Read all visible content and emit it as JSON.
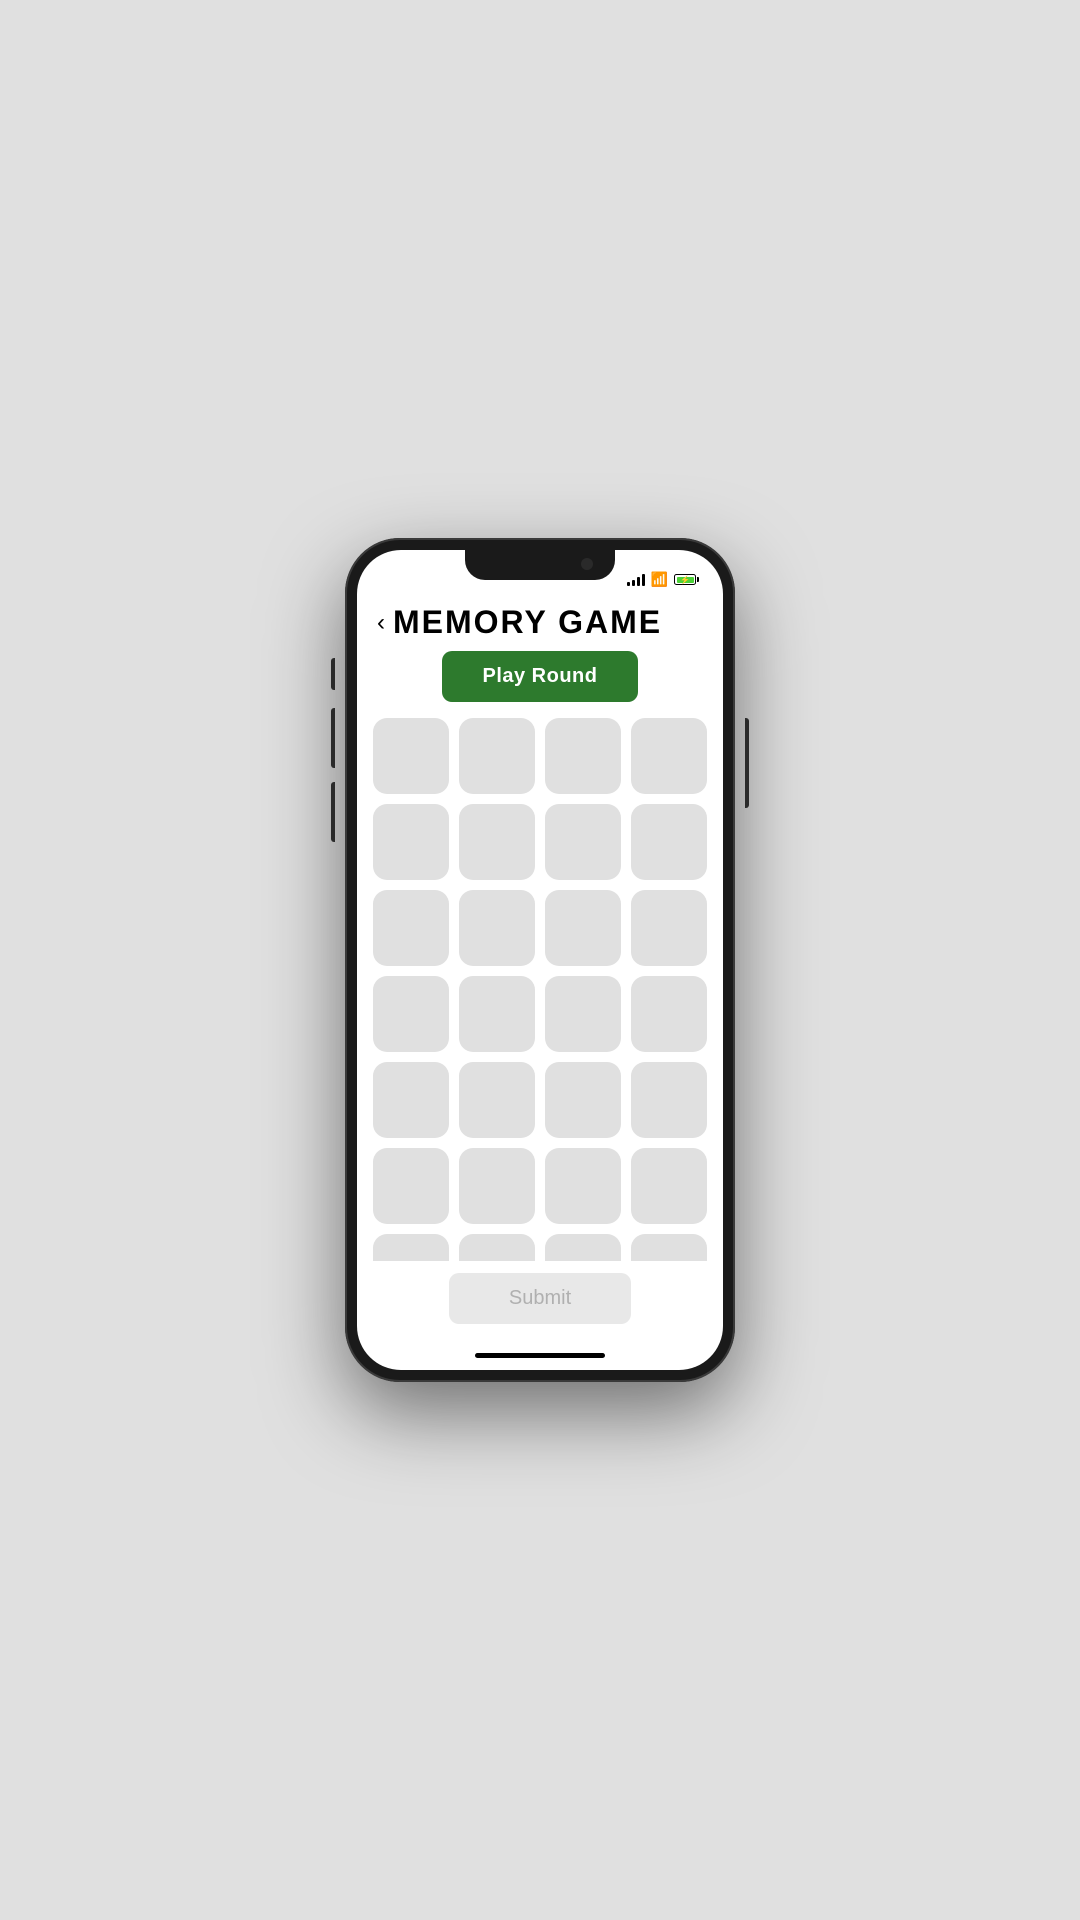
{
  "app": {
    "title": "MEMORY GAME",
    "back_label": "‹"
  },
  "header": {
    "back_button_label": "‹",
    "title": "MEMORY GAME"
  },
  "buttons": {
    "play_round_label": "Play Round",
    "submit_label": "Submit"
  },
  "grid": {
    "rows": 7,
    "cols": 4,
    "total_cards": 28
  },
  "status_bar": {
    "battery_color": "#4cd137"
  },
  "colors": {
    "play_round_bg": "#2d7a2d",
    "play_round_text": "#ffffff",
    "card_bg": "#e0e0e0",
    "submit_bg": "#e8e8e8",
    "submit_text": "#b0b0b0",
    "title_color": "#000000"
  }
}
